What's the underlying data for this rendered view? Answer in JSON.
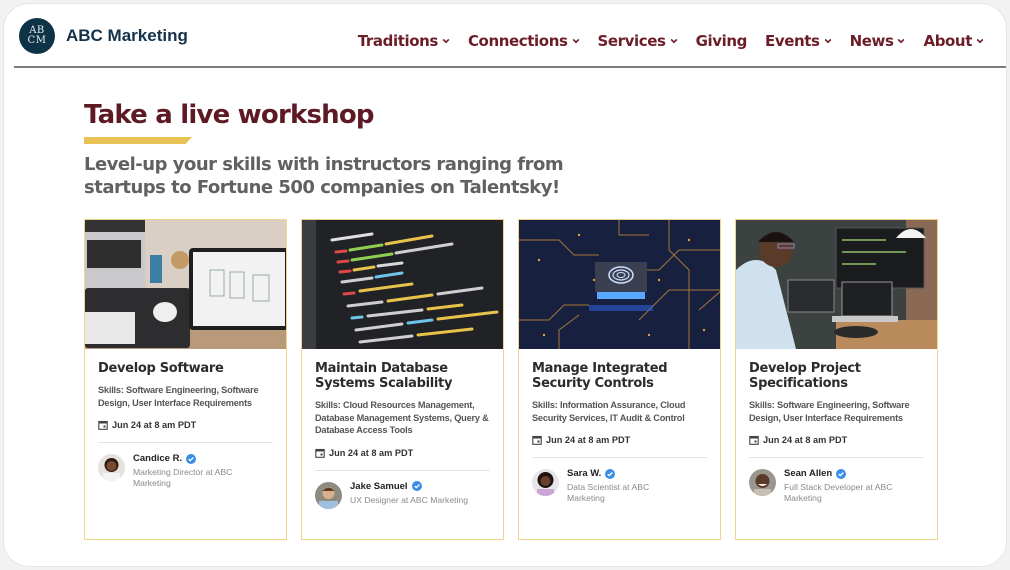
{
  "header": {
    "logo_text_top": "AB",
    "logo_text_bottom": "CM",
    "brand_name": "ABC Marketing",
    "nav": [
      {
        "label": "Traditions",
        "has_dropdown": true
      },
      {
        "label": "Connections",
        "has_dropdown": true
      },
      {
        "label": "Services",
        "has_dropdown": true
      },
      {
        "label": "Giving",
        "has_dropdown": false
      },
      {
        "label": "Events",
        "has_dropdown": true
      },
      {
        "label": "News",
        "has_dropdown": true
      },
      {
        "label": "About",
        "has_dropdown": true
      }
    ]
  },
  "hero": {
    "title": "Take a live workshop",
    "subtitle": "Level-up your skills with instructors ranging from startups to Fortune 500 companies on Talentsky!"
  },
  "colors": {
    "brand_navy": "#0e3347",
    "accent_maroon": "#6b1d28",
    "accent_gold": "#e8c255",
    "card_border": "#f1d48a",
    "verified_blue": "#3b8ee6"
  },
  "workshops": [
    {
      "image": "workspace-laptop-tablet-photo",
      "title": "Develop Software",
      "skills": "Skills: Software Engineering, Software Design, User Interface Requirements",
      "date": "Jun 24 at 8 am PDT",
      "instructor": {
        "name": "Candice R.",
        "verified": true,
        "role": "Marketing Director at ABC Marketing"
      }
    },
    {
      "image": "code-on-screen-photo",
      "title": "Maintain Database Systems Scalability",
      "skills": "Skills: Cloud Resources Management, Database Management Systems, Query & Database Access Tools",
      "date": "Jun 24 at 8 am PDT",
      "instructor": {
        "name": "Jake Samuel",
        "verified": true,
        "role": "UX Designer at ABC Marketing"
      }
    },
    {
      "image": "fingerprint-circuit-photo",
      "title": "Manage Integrated Security Controls",
      "skills": "Skills: Information Assurance, Cloud Security Services, IT Audit & Control",
      "date": "Jun 24 at 8 am PDT",
      "instructor": {
        "name": "Sara W.",
        "verified": true,
        "role": "Data Scientist at ABC Marketing"
      }
    },
    {
      "image": "developer-at-monitors-photo",
      "title": "Develop Project Specifications",
      "skills": "Skills: Software Engineering, Software Design, User Interface Requirements",
      "date": "Jun 24 at 8 am PDT",
      "instructor": {
        "name": "Sean Allen",
        "verified": true,
        "role": "Full Stack Developer at ABC Marketing"
      }
    }
  ]
}
